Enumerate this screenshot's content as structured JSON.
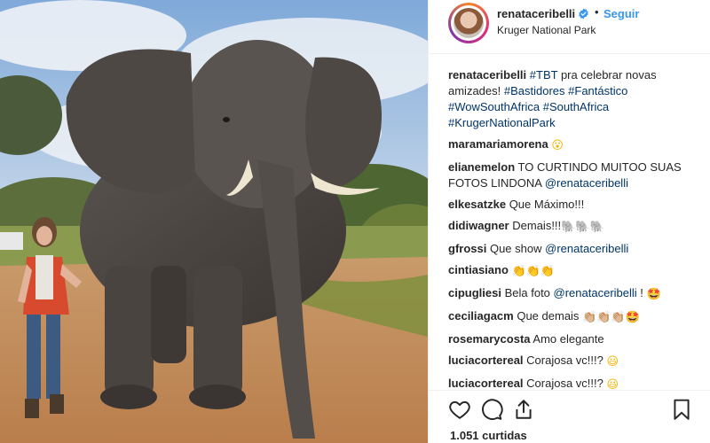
{
  "post": {
    "username": "renataceribelli",
    "location": "Kruger National Park",
    "follow_label": "Seguir",
    "separator": "•"
  },
  "caption": {
    "username": "renataceribelli",
    "parts": [
      {
        "text": "#TBT",
        "type": "tag"
      },
      {
        "text": " pra celebrar novas amizades!",
        "type": "text"
      },
      {
        "text": " ",
        "type": "text"
      },
      {
        "text": "#Bastidores",
        "type": "tag"
      },
      {
        "text": " ",
        "type": "text"
      },
      {
        "text": "#Fantástico",
        "type": "tag"
      },
      {
        "text": " ",
        "type": "text"
      },
      {
        "text": "#WowSouthAfrica",
        "type": "tag"
      },
      {
        "text": " ",
        "type": "text"
      },
      {
        "text": "#SouthAfrica",
        "type": "tag"
      },
      {
        "text": " ",
        "type": "text"
      },
      {
        "text": "#KrugerNationalPark",
        "type": "tag"
      }
    ]
  },
  "comments": [
    {
      "user": "maramariamorena",
      "parts": [
        {
          "text": "😮",
          "type": "emoji",
          "color": "yellow"
        }
      ]
    },
    {
      "user": "elianemelon",
      "parts": [
        {
          "text": "TO CURTINDO MUITOO SUAS FOTOS LINDONA ",
          "type": "text"
        },
        {
          "text": "@renataceribelli",
          "type": "tag"
        }
      ]
    },
    {
      "user": "elkesatzke",
      "parts": [
        {
          "text": "Que Máximo!!!",
          "type": "text"
        }
      ]
    },
    {
      "user": "didiwagner",
      "parts": [
        {
          "text": "Demais!!!",
          "type": "text"
        },
        {
          "text": "🐘🐘🐘",
          "type": "emoji",
          "color": "gray"
        }
      ]
    },
    {
      "user": "gfrossi",
      "parts": [
        {
          "text": "Que show ",
          "type": "text"
        },
        {
          "text": "@renataceribelli",
          "type": "tag"
        }
      ]
    },
    {
      "user": "cintiasiano",
      "parts": [
        {
          "text": "👏👏👏",
          "type": "emoji",
          "color": "yellow"
        }
      ]
    },
    {
      "user": "cipugliesi",
      "parts": [
        {
          "text": "Bela foto ",
          "type": "text"
        },
        {
          "text": "@renataceribelli",
          "type": "tag"
        },
        {
          "text": " ! ",
          "type": "text"
        },
        {
          "text": "🤩",
          "type": "emoji",
          "color": "red"
        }
      ]
    },
    {
      "user": "ceciliagacm",
      "parts": [
        {
          "text": "Que demais ",
          "type": "text"
        },
        {
          "text": "👏🏼👏🏼👏🏼",
          "type": "emoji",
          "color": "skin"
        },
        {
          "text": "🤩",
          "type": "emoji",
          "color": "red"
        }
      ]
    },
    {
      "user": "rosemarycosta",
      "parts": [
        {
          "text": "Amo elegante",
          "type": "text"
        }
      ]
    },
    {
      "user": "luciacortereal",
      "parts": [
        {
          "text": "Corajosa vc!!!? ",
          "type": "text"
        },
        {
          "text": "😃",
          "type": "emoji",
          "color": "yellow"
        }
      ]
    },
    {
      "user": "luciacortereal",
      "parts": [
        {
          "text": "Corajosa vc!!!? ",
          "type": "text"
        },
        {
          "text": "😃",
          "type": "emoji",
          "color": "yellow"
        }
      ]
    }
  ],
  "footer": {
    "likes": "1.051 curtidas"
  },
  "icons": {
    "like": "heart-icon",
    "comment": "comment-icon",
    "share": "share-icon",
    "save": "bookmark-icon",
    "verified": "verified-badge-icon"
  },
  "colors": {
    "link": "#003569",
    "follow": "#3897f0",
    "verified": "#3897f0"
  }
}
